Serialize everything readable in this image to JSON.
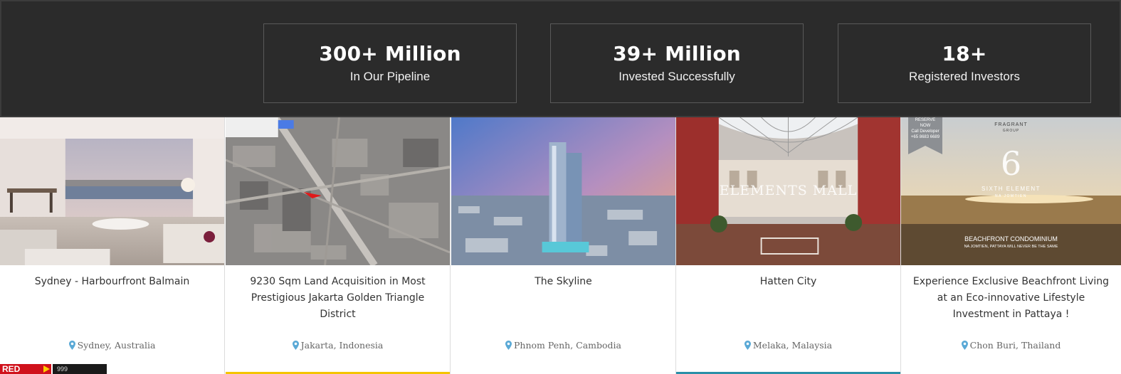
{
  "stats": [
    {
      "value": "300+ Million",
      "label": "In Our Pipeline"
    },
    {
      "value": "39+ Million",
      "label": "Invested Successfully"
    },
    {
      "value": "18+",
      "label": "Registered Investors"
    }
  ],
  "properties": [
    {
      "title": "Sydney - Harbourfront Balmain",
      "location": "Sydney, Australia"
    },
    {
      "title": "9230 Sqm Land Acquisition in Most Prestigious Jakarta Golden Triangle District",
      "location": "Jakarta, Indonesia"
    },
    {
      "title": "The Skyline",
      "location": "Phnom Penh, Cambodia"
    },
    {
      "title": "Hatten City",
      "location": "Melaka, Malaysia",
      "image_text": "ELEMENTS MALL"
    },
    {
      "title": "Experience Exclusive Beachfront Living at an Eco-innovative Lifestyle Investment in Pattaya !",
      "location": "Chon Buri, Thailand",
      "image_text": {
        "badge": "RESERVE NOW",
        "badge_sub": "Call Developer",
        "badge_phone": "+65 8683 6689",
        "brand": "FRAGRANT",
        "brand_sub": "GROUP",
        "logo_numeral": "6",
        "project": "SIXTH ELEMENT",
        "project_sub": "NA JOMTIEN",
        "tagline": "BEACHFRONT CONDOMINIUM",
        "tagline_sub": "NA JOMTIEN, PATTAYA WILL NEVER BE THE SAME"
      }
    }
  ],
  "footer_logos": {
    "left": "RED",
    "right": "999"
  },
  "colors": {
    "band_background": "#2b2b2b",
    "stat_border": "#5a5a5a",
    "pin": "#5aa9d6",
    "title_text": "#333333",
    "accent_yellow": "#f4c400",
    "accent_teal": "#2a8fa8"
  },
  "icons": {
    "location": "map-pin-icon"
  }
}
